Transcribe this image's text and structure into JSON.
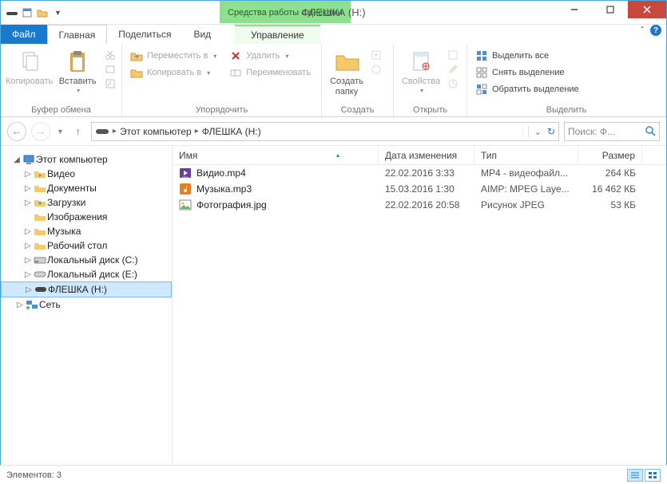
{
  "window": {
    "title": "ФЛЕШКА (H:)",
    "context_tab": "Средства работы с дисками"
  },
  "tabs": {
    "file": "Файл",
    "home": "Главная",
    "share": "Поделиться",
    "view": "Вид",
    "manage": "Управление"
  },
  "ribbon": {
    "clipboard": {
      "label": "Буфер обмена",
      "copy": "Копировать",
      "paste": "Вставить"
    },
    "organize": {
      "label": "Упорядочить",
      "move_to": "Переместить в",
      "copy_to": "Копировать в",
      "delete": "Удалить",
      "rename": "Переименовать"
    },
    "new": {
      "label": "Создать",
      "new_folder_l1": "Создать",
      "new_folder_l2": "папку"
    },
    "open": {
      "label": "Открыть",
      "properties": "Свойства"
    },
    "select": {
      "label": "Выделить",
      "select_all": "Выделить все",
      "select_none": "Снять выделение",
      "invert": "Обратить выделение"
    }
  },
  "breadcrumbs": {
    "root": "Этот компьютер",
    "current": "ФЛЕШКА (H:)"
  },
  "search": {
    "placeholder": "Поиск: Ф..."
  },
  "tree": {
    "this_pc": "Этот компьютер",
    "videos": "Видео",
    "documents": "Документы",
    "downloads": "Загрузки",
    "pictures": "Изображения",
    "music": "Музыка",
    "desktop": "Рабочий стол",
    "disk_c": "Локальный диск (C:)",
    "disk_e": "Локальный диск (E:)",
    "flash_h": "ФЛЕШКА (H:)",
    "network": "Сеть"
  },
  "columns": {
    "name": "Имя",
    "date": "Дата изменения",
    "type": "Тип",
    "size": "Размер"
  },
  "files": [
    {
      "name": "Видио.mp4",
      "date": "22.02.2016 3:33",
      "type": "MP4 - видеофайл...",
      "size": "264 КБ",
      "icon": "video"
    },
    {
      "name": "Музыка.mp3",
      "date": "15.03.2016 1:30",
      "type": "AIMP: MPEG Laye...",
      "size": "16 462 КБ",
      "icon": "audio"
    },
    {
      "name": "Фотография.jpg",
      "date": "22.02.2016 20:58",
      "type": "Рисунок JPEG",
      "size": "53 КБ",
      "icon": "image"
    }
  ],
  "status": {
    "count_label": "Элементов: 3"
  }
}
